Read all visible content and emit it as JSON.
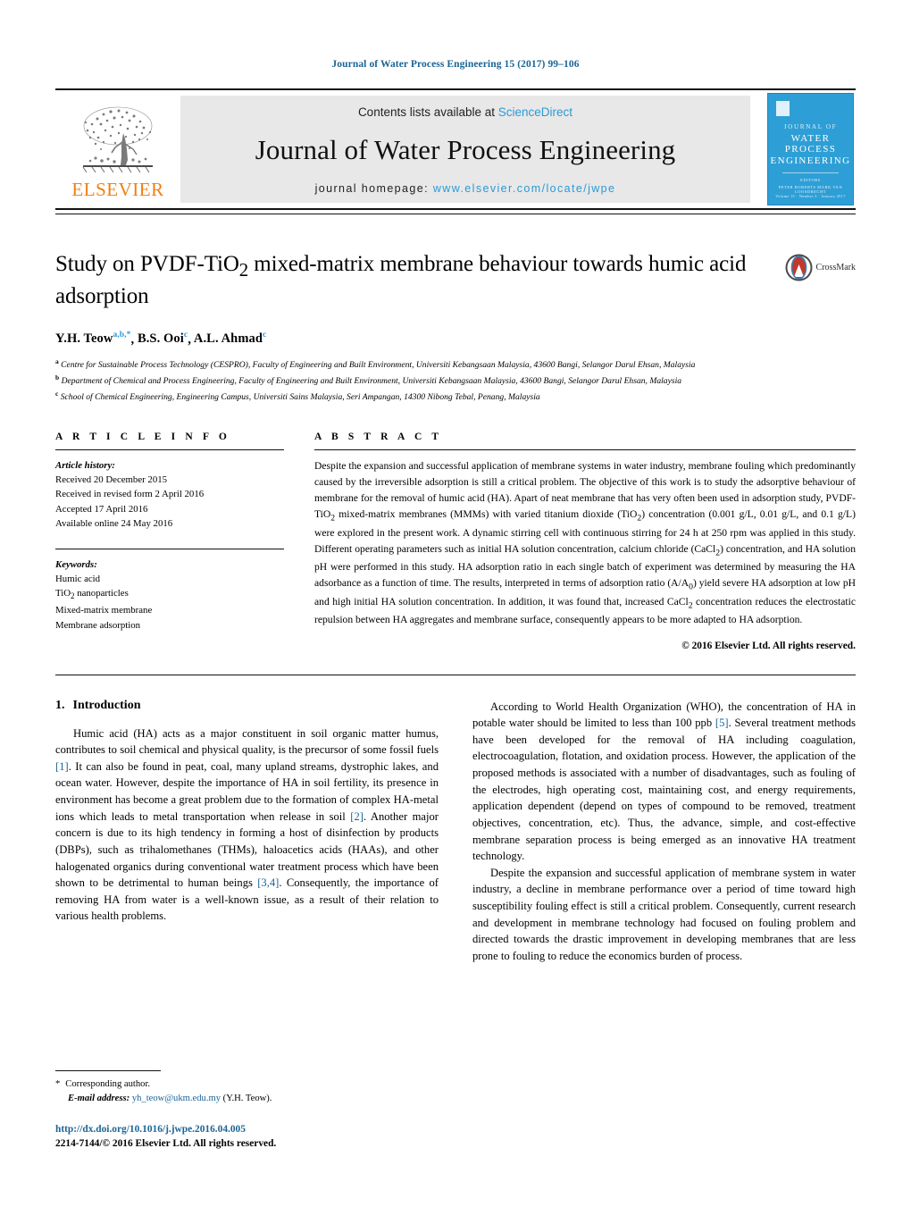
{
  "running_head": "Journal of Water Process Engineering 15 (2017) 99–106",
  "masthead": {
    "publisher_wordmark": "ELSEVIER",
    "contents_prefix": "Contents lists available at ",
    "contents_link": "ScienceDirect",
    "journal_title": "Journal of Water Process Engineering",
    "homepage_prefix": "journal homepage: ",
    "homepage_url": "www.elsevier.com/locate/jwpe",
    "cover": {
      "line1": "JOURNAL OF",
      "line2": "WATER PROCESS",
      "line3": "ENGINEERING",
      "line4": "EDITORS",
      "line5": "PETER ROBERTS    MARK VAN LOOSDRECHT",
      "footer": "Volume 15 · Number 3 · January 2017"
    }
  },
  "article": {
    "title": "Study on PVDF-TiO2 mixed-matrix membrane behaviour towards humic acid adsorption",
    "crossmark_label": "CrossMark",
    "authors": [
      {
        "name": "Y.H. Teow",
        "marks": "a,b,*"
      },
      {
        "name": "B.S. Ooi",
        "marks": "c"
      },
      {
        "name": "A.L. Ahmad",
        "marks": "c"
      }
    ],
    "affiliations": [
      {
        "mark": "a",
        "text": "Centre for Sustainable Process Technology (CESPRO), Faculty of Engineering and Built Environment, Universiti Kebangsaan Malaysia, 43600 Bangi, Selangor Darul Ehsan, Malaysia"
      },
      {
        "mark": "b",
        "text": "Department of Chemical and Process Engineering, Faculty of Engineering and Built Environment, Universiti Kebangsaan Malaysia, 43600 Bangi, Selangor Darul Ehsan, Malaysia"
      },
      {
        "mark": "c",
        "text": "School of Chemical Engineering, Engineering Campus, Universiti Sains Malaysia, Seri Ampangan, 14300 Nibong Tebal, Penang, Malaysia"
      }
    ]
  },
  "article_info": {
    "heading": "A R T I C L E   I N F O",
    "history_title": "Article history:",
    "history": [
      "Received 20 December 2015",
      "Received in revised form 2 April 2016",
      "Accepted 17 April 2016",
      "Available online 24 May 2016"
    ],
    "keywords_title": "Keywords:",
    "keywords": [
      "Humic acid",
      "TiO2 nanoparticles",
      "Mixed-matrix membrane",
      "Membrane adsorption"
    ]
  },
  "abstract": {
    "heading": "A B S T R A C T",
    "text": "Despite the expansion and successful application of membrane systems in water industry, membrane fouling which predominantly caused by the irreversible adsorption is still a critical problem. The objective of this work is to study the adsorptive behaviour of membrane for the removal of humic acid (HA). Apart of neat membrane that has very often been used in adsorption study, PVDF-TiO2 mixed-matrix membranes (MMMs) with varied titanium dioxide (TiO2) concentration (0.001 g/L, 0.01 g/L, and 0.1 g/L) were explored in the present work. A dynamic stirring cell with continuous stirring for 24 h at 250 rpm was applied in this study. Different operating parameters such as initial HA solution concentration, calcium chloride (CaCl2) concentration, and HA solution pH were performed in this study. HA adsorption ratio in each single batch of experiment was determined by measuring the HA adsorbance as a function of time. The results, interpreted in terms of adsorption ratio (A/A0) yield severe HA adsorption at low pH and high initial HA solution concentration. In addition, it was found that, increased CaCl2 concentration reduces the electrostatic repulsion between HA aggregates and membrane surface, consequently appears to be more adapted to HA adsorption.",
    "copyright": "© 2016 Elsevier Ltd. All rights reserved."
  },
  "introduction": {
    "number": "1.",
    "heading": "Introduction",
    "left_paragraphs": [
      "Humic acid (HA) acts as a major constituent in soil organic matter humus, contributes to soil chemical and physical quality, is the precursor of some fossil fuels [1]. It can also be found in peat, coal, many upland streams, dystrophic lakes, and ocean water. However, despite the importance of HA in soil fertility, its presence in environment has become a great problem due to the formation of complex HA-metal ions which leads to metal transportation when release in soil [2]. Another major concern is due to its high tendency in forming a host of disinfection by products (DBPs), such as trihalomethanes (THMs), haloacetics acids (HAAs), and other halogenated organics during conventional water treatment process which have been shown to be detrimental to human beings [3,4]. Consequently, the importance of removing HA from water is a well-known issue, as a result of their relation to various health problems."
    ],
    "right_paragraphs": [
      "According to World Health Organization (WHO), the concentration of HA in potable water should be limited to less than 100 ppb [5]. Several treatment methods have been developed for the removal of HA including coagulation, electrocoagulation, flotation, and oxidation process. However, the application of the proposed methods is associated with a number of disadvantages, such as fouling of the electrodes, high operating cost, maintaining cost, and energy requirements, application dependent (depend on types of compound to be removed, treatment objectives, concentration, etc). Thus, the advance, simple, and cost-effective membrane separation process is being emerged as an innovative HA treatment technology.",
      "Despite the expansion and successful application of membrane system in water industry, a decline in membrane performance over a period of time toward high susceptibility fouling effect is still a critical problem. Consequently, current research and development in membrane technology had focused on fouling problem and directed towards the drastic improvement in developing membranes that are less prone to fouling to reduce the economics burden of process."
    ]
  },
  "footnote": {
    "corresponding_star": "*",
    "corresponding_text": "Corresponding author.",
    "email_label": "E-mail address:",
    "email": "yh_teow@ukm.edu.my",
    "email_owner": "(Y.H. Teow).",
    "doi": "http://dx.doi.org/10.1016/j.jwpe.2016.04.005",
    "issn_line": "2214-7144/© 2016 Elsevier Ltd. All rights reserved."
  },
  "colors": {
    "link_blue": "#1a6496",
    "sciencedirect_blue": "#2b9ad6",
    "elsevier_orange": "#f07f13",
    "cover_blue": "#2e9fd6"
  }
}
